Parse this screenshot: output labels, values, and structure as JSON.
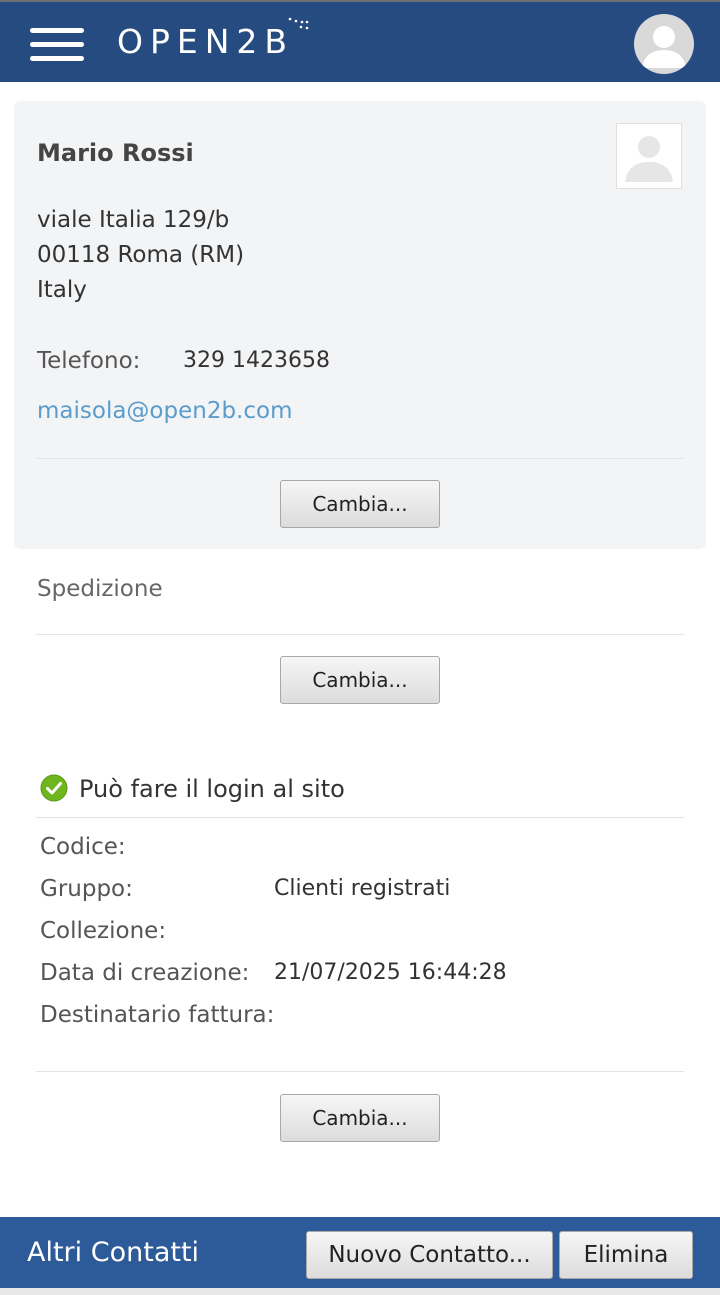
{
  "header": {
    "logo_text": "OPEN2B",
    "menu_icon": "hamburger-menu-icon",
    "avatar_icon": "user-avatar-icon"
  },
  "customer": {
    "name": "Mario Rossi",
    "address_line1": "viale Italia 129/b",
    "address_line2": "00118 Roma (RM)",
    "country": "Italy",
    "phone_label": "Telefono:",
    "phone_value": "329 1423658",
    "email": "maisola@open2b.com",
    "change_label": "Cambia..."
  },
  "shipping": {
    "title": "Spedizione",
    "change_label": "Cambia..."
  },
  "account": {
    "login_text": "Può fare il login al sito",
    "fields": [
      {
        "label": "Codice:",
        "value": ""
      },
      {
        "label": "Gruppo:",
        "value": "Clienti registrati"
      },
      {
        "label": "Collezione:",
        "value": ""
      },
      {
        "label": "Data di creazione:",
        "value": "21/07/2025 16:44:28"
      },
      {
        "label": "Destinatario fattura:",
        "value": ""
      }
    ],
    "change_label": "Cambia..."
  },
  "contacts_bar": {
    "title": "Altri Contatti",
    "new_contact_label": "Nuovo Contatto...",
    "delete_label": "Elimina"
  },
  "colors": {
    "header_bg": "#264b80",
    "footer_bg": "#2d5a98",
    "card_bg": "#f3f4f6",
    "email_link": "#5a9ccc",
    "check_green": "#6fb51e"
  }
}
